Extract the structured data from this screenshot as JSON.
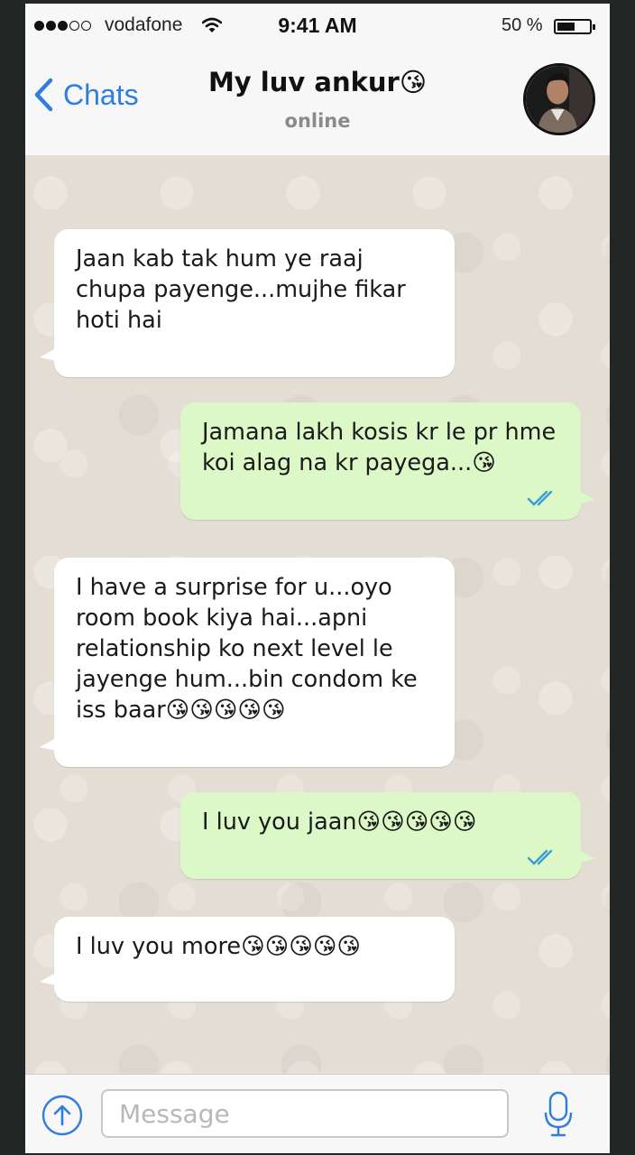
{
  "status_bar": {
    "carrier": "vodafone",
    "time": "9:41 AM",
    "battery_percent": "50 %",
    "battery_level": 0.5,
    "signal_bars": 3,
    "signal_total": 5
  },
  "header": {
    "back_label": "Chats",
    "contact_name": "My luv ankur😘",
    "contact_status": "online"
  },
  "messages": [
    {
      "direction": "in",
      "text": "Jaan kab tak hum ye raaj\nchupa payenge...mujhe fikar\nhoti hai"
    },
    {
      "direction": "out",
      "text": "Jamana lakh kosis kr le pr hme\nkoi alag na kr payega...😘",
      "read": true
    },
    {
      "direction": "in",
      "text": "I have a surprise for u...oyo\nroom book kiya hai...apni\nrelationship ko next level le\njayenge hum...bin condom ke\niss baar😘😘😘😘😘"
    },
    {
      "direction": "out",
      "text": "I luv you jaan😘😘😘😘😘",
      "read": true
    },
    {
      "direction": "in",
      "text": "I luv you more😘😘😘😘😘"
    }
  ],
  "input": {
    "placeholder": "Message"
  },
  "colors": {
    "accent": "#2f7de1",
    "incoming_bubble": "#ffffff",
    "outgoing_bubble": "#dcf8c6",
    "read_ticks": "#3a9bd9",
    "chat_background": "#e4ddd3"
  },
  "icons": {
    "back": "chevron-left-icon",
    "wifi": "wifi-icon",
    "upload": "upload-arrow-icon",
    "mic": "microphone-icon",
    "read_receipt": "double-check-icon"
  }
}
